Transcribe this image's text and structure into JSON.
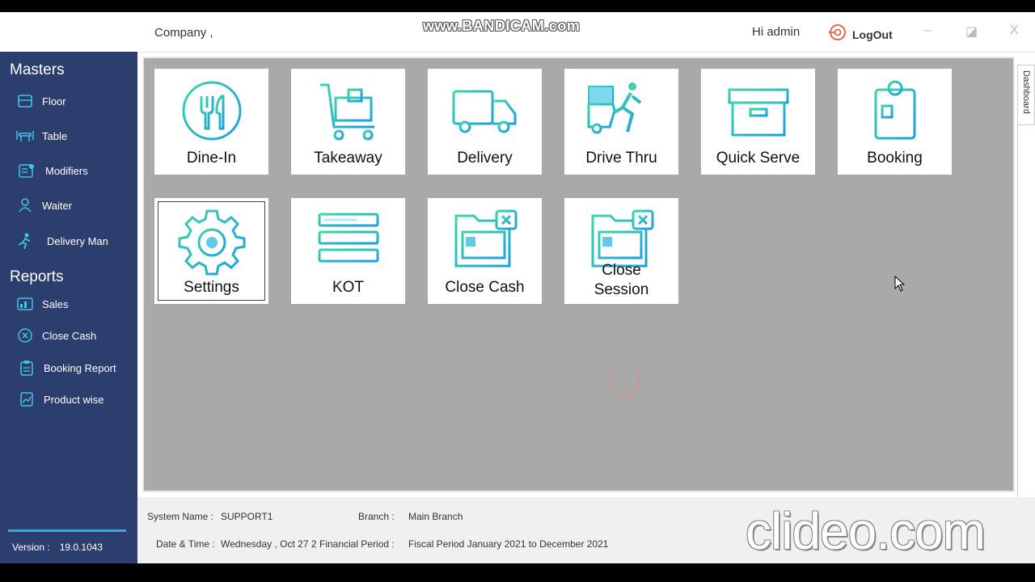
{
  "titlebar": {
    "company": "Company ,",
    "recorder_watermark": "www.BANDICAM.com",
    "greeting": "Hi admin",
    "logout_label": "LogOut",
    "minimize_glyph": "–",
    "maximize_glyph": "◪",
    "close_glyph": "X"
  },
  "sidebar": {
    "masters_title": "Masters",
    "masters": [
      {
        "label": "Floor",
        "icon": "floor-icon"
      },
      {
        "label": "Table",
        "icon": "table-icon"
      },
      {
        "label": "Modifiers",
        "icon": "modifiers-icon"
      },
      {
        "label": "Waiter",
        "icon": "waiter-icon"
      },
      {
        "label": "Delivery Man",
        "icon": "delivery-man-icon"
      }
    ],
    "reports_title": "Reports",
    "reports": [
      {
        "label": "Sales",
        "icon": "sales-icon"
      },
      {
        "label": "Close Cash",
        "icon": "close-cash-icon"
      },
      {
        "label": "Booking Report",
        "icon": "booking-report-icon"
      },
      {
        "label": "Product wise",
        "icon": "product-wise-icon"
      }
    ],
    "version_label": "Version :",
    "version_value": "19.0.1043"
  },
  "tiles": [
    {
      "label": "Dine-In",
      "icon": "dine-in-icon"
    },
    {
      "label": "Takeaway",
      "icon": "takeaway-cart-icon"
    },
    {
      "label": "Delivery",
      "icon": "delivery-truck-icon"
    },
    {
      "label": "Drive Thru",
      "icon": "drive-thru-icon"
    },
    {
      "label": "Quick Serve",
      "icon": "quick-serve-box-icon"
    },
    {
      "label": "Booking",
      "icon": "booking-clipboard-icon"
    },
    {
      "label": "Settings",
      "icon": "settings-gear-icon"
    },
    {
      "label": "KOT",
      "icon": "kot-list-icon"
    },
    {
      "label": "Close Cash",
      "icon": "close-cash-folder-icon"
    },
    {
      "label": "Close\nSession",
      "icon": "close-session-folder-icon"
    }
  ],
  "side_tab": "Dashboard",
  "status": {
    "system_name_label": "System Name :",
    "system_name_value": "SUPPORT1",
    "branch_label": "Branch :",
    "branch_value": "Main Branch",
    "datetime_label": "Date & Time :",
    "datetime_value": "Wednesday , Oct 27 2",
    "financial_period_label": "Financial Period :",
    "financial_period_value": "Fiscal Period January 2021 to December 2021"
  },
  "editor_watermark": "clideo.com",
  "colors": {
    "sidebar": "#2c3e6e",
    "accent": "#21b5d8",
    "main_bg": "#a9a9a9"
  }
}
